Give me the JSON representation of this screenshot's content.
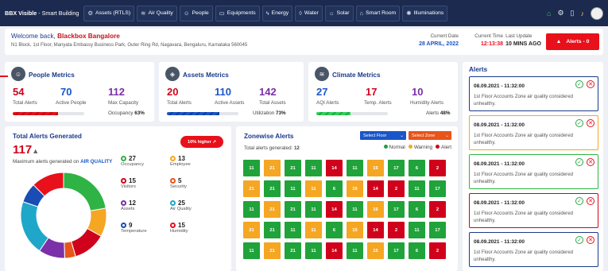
{
  "topbar": {
    "brand": "BBX Visible",
    "brand_sub": " - Smart Building",
    "tabs": [
      {
        "label": "Assets (RTLS)",
        "icon": "⚙"
      },
      {
        "label": "Air Quality",
        "icon": "≋"
      },
      {
        "label": "People",
        "icon": "☺"
      },
      {
        "label": "Equipments",
        "icon": "▭"
      },
      {
        "label": "Energy",
        "icon": "ϟ"
      },
      {
        "label": "Water",
        "icon": "◊"
      },
      {
        "label": "Solar",
        "icon": "☼"
      },
      {
        "label": "Smart Room",
        "icon": "⌂"
      },
      {
        "label": "Illuminations",
        "icon": "✺"
      }
    ]
  },
  "welcome": {
    "greeting": "Welcome back, ",
    "org": "Blackbox Bangalore",
    "address": "N1 Block, 1st Floor, Manyata Embassy Business Park, Outer Ring Rd, Nagavara, Bengaluru, Karnataka 560045",
    "current_date_label": "Current Date",
    "current_date": "28 APRIL, 2022",
    "current_time_label": "Current Time",
    "current_time": "12:13:38",
    "last_update_label": "Last Update",
    "last_update": "10 MINS AGO",
    "alerts_button": "Alerts - 0"
  },
  "people_metrics": {
    "title": "People Metrics",
    "total_alerts": "54",
    "total_alerts_label": "Total Alerts",
    "active_people": "70",
    "active_people_label": "Active People",
    "max_capacity": "112",
    "max_capacity_label": "Max Capacity",
    "occupancy_label": "Occupancy",
    "occupancy": "63%",
    "occupancy_fraction": 0.63
  },
  "assets_metrics": {
    "title": "Assets Metrics",
    "total_alerts": "20",
    "total_alerts_label": "Total Alerts",
    "active_assets": "110",
    "active_assets_label": "Active Assets",
    "total_assets": "142",
    "total_assets_label": "Total Assets",
    "utilization_label": "Utilization",
    "utilization": "73%",
    "utilization_fraction": 0.73
  },
  "climate_metrics": {
    "title": "Climate Metrics",
    "aqi_alerts": "27",
    "aqi_alerts_label": "AQI Alerts",
    "temp_alerts": "17",
    "temp_alerts_label": "Temp. Alerts",
    "humidity_alerts": "10",
    "humidity_alerts_label": "Humidity Alerts",
    "alerts_label": "Alerts",
    "alerts_pct": "48%",
    "alerts_fraction": 0.48
  },
  "total_alerts": {
    "title": "Total Alerts Generated",
    "value": "117",
    "higher_tag": "10% higher ↗",
    "subtitle_prefix": "Maximum alerts generated on ",
    "subtitle_highlight": "AIR QUALITY",
    "categories": [
      {
        "value": "27",
        "label": "Occupancy",
        "color": "#2fb344"
      },
      {
        "value": "13",
        "label": "Employee",
        "color": "#f5a623"
      },
      {
        "value": "15",
        "label": "Visitors",
        "color": "#d0021b"
      },
      {
        "value": "5",
        "label": "Security",
        "color": "#e8541a"
      },
      {
        "value": "12",
        "label": "Assets",
        "color": "#7b2fa8"
      },
      {
        "value": "25",
        "label": "Air Quality",
        "color": "#1fa7c9"
      },
      {
        "value": "9",
        "label": "Temperature",
        "color": "#1a4db3"
      },
      {
        "value": "15",
        "label": "Humidity",
        "color": "#e8101a"
      }
    ]
  },
  "zonewise": {
    "title": "Zonewise Alerts",
    "select_floor": "Select Floor",
    "select_zone": "Select Zone",
    "generated_label": "Total alerts generated: ",
    "generated_value": "12",
    "legend": [
      {
        "label": "Normal",
        "color": "#1fa33a"
      },
      {
        "label": "Warning",
        "color": "#f5a623"
      },
      {
        "label": "Alert",
        "color": "#d0021b"
      }
    ],
    "rows": [
      [
        {
          "v": "11",
          "s": "n"
        },
        {
          "v": "21",
          "s": "w"
        },
        {
          "v": "21",
          "s": "n"
        },
        {
          "v": "11",
          "s": "n"
        },
        {
          "v": "14",
          "s": "a"
        },
        {
          "v": "11",
          "s": "n"
        },
        {
          "v": "15",
          "s": "w"
        },
        {
          "v": "17",
          "s": "n"
        },
        {
          "v": "6",
          "s": "n"
        },
        {
          "v": "2",
          "s": "a"
        }
      ],
      [
        {
          "v": "21",
          "s": "w"
        },
        {
          "v": "21",
          "s": "n"
        },
        {
          "v": "11",
          "s": "n"
        },
        {
          "v": "11",
          "s": "w"
        },
        {
          "v": "6",
          "s": "n"
        },
        {
          "v": "15",
          "s": "w"
        },
        {
          "v": "14",
          "s": "a"
        },
        {
          "v": "2",
          "s": "a"
        },
        {
          "v": "11",
          "s": "n"
        },
        {
          "v": "17",
          "s": "n"
        }
      ],
      [
        {
          "v": "11",
          "s": "n"
        },
        {
          "v": "21",
          "s": "w"
        },
        {
          "v": "21",
          "s": "n"
        },
        {
          "v": "11",
          "s": "n"
        },
        {
          "v": "14",
          "s": "a"
        },
        {
          "v": "11",
          "s": "n"
        },
        {
          "v": "15",
          "s": "w"
        },
        {
          "v": "17",
          "s": "n"
        },
        {
          "v": "6",
          "s": "n"
        },
        {
          "v": "2",
          "s": "a"
        }
      ],
      [
        {
          "v": "21",
          "s": "w"
        },
        {
          "v": "21",
          "s": "n"
        },
        {
          "v": "11",
          "s": "n"
        },
        {
          "v": "11",
          "s": "w"
        },
        {
          "v": "6",
          "s": "n"
        },
        {
          "v": "15",
          "s": "w"
        },
        {
          "v": "14",
          "s": "a"
        },
        {
          "v": "2",
          "s": "a"
        },
        {
          "v": "11",
          "s": "n"
        },
        {
          "v": "17",
          "s": "n"
        }
      ],
      [
        {
          "v": "11",
          "s": "n"
        },
        {
          "v": "21",
          "s": "w"
        },
        {
          "v": "21",
          "s": "n"
        },
        {
          "v": "11",
          "s": "n"
        },
        {
          "v": "14",
          "s": "a"
        },
        {
          "v": "11",
          "s": "n"
        },
        {
          "v": "15",
          "s": "w"
        },
        {
          "v": "17",
          "s": "n"
        },
        {
          "v": "6",
          "s": "n"
        },
        {
          "v": "2",
          "s": "a"
        }
      ]
    ]
  },
  "alerts_panel": {
    "title": "Alerts",
    "items": [
      {
        "timestamp": "08.09.2021 - 11:32:00",
        "message": "1st Floor Accounts Zone air quality considered unhealthy.",
        "border": "#1a3a8a"
      },
      {
        "timestamp": "08.09.2021 - 11:32:00",
        "message": "1st Floor Accounts Zone air quality considered unhealthy.",
        "border": "#f5a623"
      },
      {
        "timestamp": "08.09.2021 - 11:32:00",
        "message": "1st Floor Accounts Zone air quality considered unhealthy.",
        "border": "#2fb344"
      },
      {
        "timestamp": "08.09.2021 - 11:32:00",
        "message": "1st Floor Accounts Zone air quality considered unhealthy.",
        "border": "#d0021b"
      },
      {
        "timestamp": "08.09.2021 - 11:32:00",
        "message": "1st Floor Accounts Zone air quality considered unhealthy.",
        "border": "#1a3a8a"
      }
    ]
  },
  "colors": {
    "normal": "#1fa33a",
    "warning": "#f5a623",
    "alert": "#d0021b",
    "accent_red": "#e8101a",
    "navy": "#1b2a4e"
  }
}
